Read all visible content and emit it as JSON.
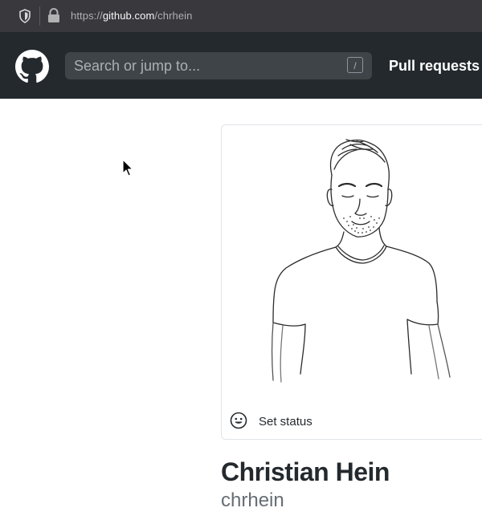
{
  "browser": {
    "url_prefix": "https://",
    "url_domain": "github.com",
    "url_path": "/chrhein"
  },
  "header": {
    "search_placeholder": "Search or jump to...",
    "search_shortcut": "/",
    "nav_pull_requests": "Pull requests"
  },
  "profile": {
    "set_status_label": "Set status",
    "name": "Christian Hein",
    "login": "chrhein"
  },
  "colors": {
    "header_bg": "#24292e",
    "urlbar_bg": "#38383d"
  }
}
